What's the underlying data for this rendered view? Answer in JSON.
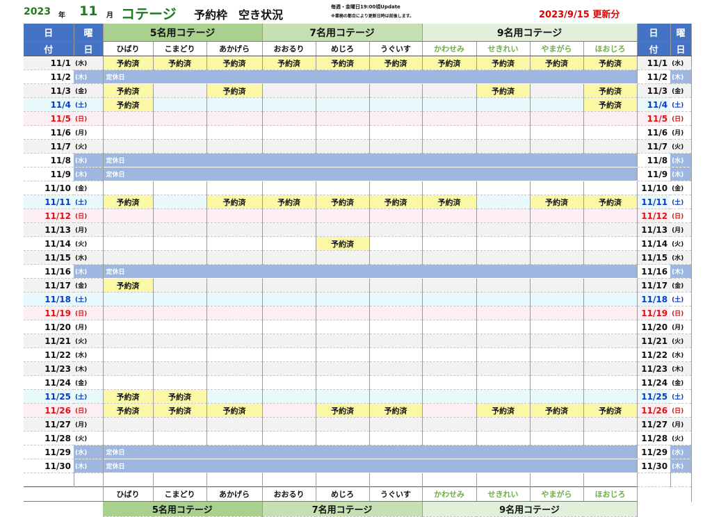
{
  "header": {
    "year": "2023",
    "year_suffix": "年",
    "month": "11",
    "month_suffix": "月",
    "title": "コテージ",
    "subtitle": "予約枠　空き状況",
    "note1": "毎週・金曜日19:00頃Update",
    "note2": "※業務の都合により更新日時は前後します。",
    "updated": "2023/9/15 更新分"
  },
  "left_header": {
    "hi": "日",
    "you": "曜",
    "tsuki": "付",
    "bi": "日"
  },
  "groups": [
    "5名用コテージ",
    "7名用コテージ",
    "9名用コテージ"
  ],
  "cottages": [
    "ひばり",
    "こまどり",
    "あかげら",
    "おおるり",
    "めじろ",
    "うぐいす",
    "かわせみ",
    "せきれい",
    "やまがら",
    "ほおじろ"
  ],
  "booked_label": "予約済",
  "holiday_label": "定休日",
  "days": [
    {
      "date": "11/1",
      "wd": "(水)",
      "kind": "normal",
      "booked": [
        1,
        1,
        1,
        1,
        1,
        1,
        1,
        1,
        1,
        1
      ]
    },
    {
      "date": "11/2",
      "wd": "(木)",
      "kind": "holiday",
      "booked": []
    },
    {
      "date": "11/3",
      "wd": "(金)",
      "kind": "normal",
      "booked": [
        1,
        0,
        1,
        0,
        0,
        0,
        0,
        1,
        0,
        1
      ]
    },
    {
      "date": "11/4",
      "wd": "(土)",
      "kind": "sat",
      "booked": [
        1,
        0,
        0,
        0,
        0,
        0,
        0,
        0,
        0,
        1
      ]
    },
    {
      "date": "11/5",
      "wd": "(日)",
      "kind": "sun",
      "booked": [
        0,
        0,
        0,
        0,
        0,
        0,
        0,
        0,
        0,
        0
      ]
    },
    {
      "date": "11/6",
      "wd": "(月)",
      "kind": "normal",
      "booked": [
        0,
        0,
        0,
        0,
        0,
        0,
        0,
        0,
        0,
        0
      ]
    },
    {
      "date": "11/7",
      "wd": "(火)",
      "kind": "normal",
      "booked": [
        0,
        0,
        0,
        0,
        0,
        0,
        0,
        0,
        0,
        0
      ]
    },
    {
      "date": "11/8",
      "wd": "(水)",
      "kind": "holiday",
      "booked": []
    },
    {
      "date": "11/9",
      "wd": "(木)",
      "kind": "holiday",
      "booked": []
    },
    {
      "date": "11/10",
      "wd": "(金)",
      "kind": "normal",
      "booked": [
        0,
        0,
        0,
        0,
        0,
        0,
        0,
        0,
        0,
        0
      ]
    },
    {
      "date": "11/11",
      "wd": "(土)",
      "kind": "sat",
      "booked": [
        1,
        0,
        1,
        1,
        1,
        1,
        1,
        0,
        1,
        1
      ]
    },
    {
      "date": "11/12",
      "wd": "(日)",
      "kind": "sun",
      "booked": [
        0,
        0,
        0,
        0,
        0,
        0,
        0,
        0,
        0,
        0
      ]
    },
    {
      "date": "11/13",
      "wd": "(月)",
      "kind": "normal",
      "booked": [
        0,
        0,
        0,
        0,
        0,
        0,
        0,
        0,
        0,
        0
      ]
    },
    {
      "date": "11/14",
      "wd": "(火)",
      "kind": "normal",
      "booked": [
        0,
        0,
        0,
        0,
        1,
        0,
        0,
        0,
        0,
        0
      ]
    },
    {
      "date": "11/15",
      "wd": "(水)",
      "kind": "normal",
      "booked": [
        0,
        0,
        0,
        0,
        0,
        0,
        0,
        0,
        0,
        0
      ]
    },
    {
      "date": "11/16",
      "wd": "(木)",
      "kind": "holiday",
      "booked": []
    },
    {
      "date": "11/17",
      "wd": "(金)",
      "kind": "normal",
      "booked": [
        1,
        0,
        0,
        0,
        0,
        0,
        0,
        0,
        0,
        0
      ]
    },
    {
      "date": "11/18",
      "wd": "(土)",
      "kind": "sat",
      "booked": [
        0,
        0,
        0,
        0,
        0,
        0,
        0,
        0,
        0,
        0
      ]
    },
    {
      "date": "11/19",
      "wd": "(日)",
      "kind": "sun",
      "booked": [
        0,
        0,
        0,
        0,
        0,
        0,
        0,
        0,
        0,
        0
      ]
    },
    {
      "date": "11/20",
      "wd": "(月)",
      "kind": "normal",
      "booked": [
        0,
        0,
        0,
        0,
        0,
        0,
        0,
        0,
        0,
        0
      ]
    },
    {
      "date": "11/21",
      "wd": "(火)",
      "kind": "normal",
      "booked": [
        0,
        0,
        0,
        0,
        0,
        0,
        0,
        0,
        0,
        0
      ]
    },
    {
      "date": "11/22",
      "wd": "(水)",
      "kind": "normal",
      "booked": [
        0,
        0,
        0,
        0,
        0,
        0,
        0,
        0,
        0,
        0
      ]
    },
    {
      "date": "11/23",
      "wd": "(木)",
      "kind": "normal",
      "booked": [
        0,
        0,
        0,
        0,
        0,
        0,
        0,
        0,
        0,
        0
      ]
    },
    {
      "date": "11/24",
      "wd": "(金)",
      "kind": "normal",
      "booked": [
        0,
        0,
        0,
        0,
        0,
        0,
        0,
        0,
        0,
        0
      ]
    },
    {
      "date": "11/25",
      "wd": "(土)",
      "kind": "sat",
      "booked": [
        1,
        1,
        0,
        0,
        0,
        0,
        0,
        0,
        0,
        0
      ]
    },
    {
      "date": "11/26",
      "wd": "(日)",
      "kind": "sun",
      "booked": [
        1,
        1,
        1,
        0,
        1,
        1,
        0,
        1,
        1,
        1
      ]
    },
    {
      "date": "11/27",
      "wd": "(月)",
      "kind": "normal",
      "booked": [
        0,
        0,
        0,
        0,
        0,
        0,
        0,
        0,
        0,
        0
      ]
    },
    {
      "date": "11/28",
      "wd": "(火)",
      "kind": "normal",
      "booked": [
        0,
        0,
        0,
        0,
        0,
        0,
        0,
        0,
        0,
        0
      ]
    },
    {
      "date": "11/29",
      "wd": "(水)",
      "kind": "holiday",
      "booked": []
    },
    {
      "date": "11/30",
      "wd": "(木)",
      "kind": "holiday",
      "booked": []
    }
  ],
  "colors": {
    "booked": "#fbf7a5",
    "holiday": "#9db7e0",
    "header_blue": "#4472c4",
    "g5": "#a9d08e",
    "g7": "#c6e0b4",
    "g9": "#e2efda",
    "saturday": "#0a3bc6",
    "sunday": "#e01010",
    "title_green": "#1e7b1e",
    "update_red": "#e00000"
  }
}
